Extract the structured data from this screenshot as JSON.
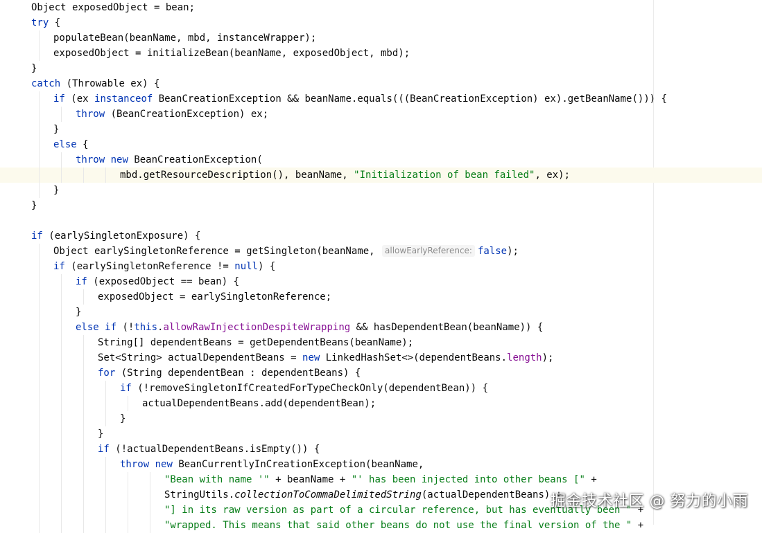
{
  "editor": {
    "lines": [
      {
        "indent": 1,
        "tokens": [
          {
            "t": "Object exposedObject = bean;"
          }
        ]
      },
      {
        "indent": 1,
        "tokens": [
          {
            "t": "try",
            "c": "kw"
          },
          {
            "t": " {"
          }
        ]
      },
      {
        "indent": 2,
        "tokens": [
          {
            "t": "populateBean(beanName, mbd, instanceWrapper);"
          }
        ]
      },
      {
        "indent": 2,
        "tokens": [
          {
            "t": "exposedObject = initializeBean(beanName, exposedObject, mbd);"
          }
        ]
      },
      {
        "indent": 1,
        "tokens": [
          {
            "t": "}"
          }
        ]
      },
      {
        "indent": 1,
        "tokens": [
          {
            "t": "catch",
            "c": "kw"
          },
          {
            "t": " (Throwable ex) {"
          }
        ]
      },
      {
        "indent": 2,
        "tokens": [
          {
            "t": "if",
            "c": "kw"
          },
          {
            "t": " (ex "
          },
          {
            "t": "instanceof",
            "c": "kw"
          },
          {
            "t": " BeanCreationException && beanName.equals(((BeanCreationException) ex).getBeanName())) {"
          }
        ]
      },
      {
        "indent": 3,
        "tokens": [
          {
            "t": "throw",
            "c": "kw"
          },
          {
            "t": " (BeanCreationException) ex;"
          }
        ]
      },
      {
        "indent": 2,
        "tokens": [
          {
            "t": "}"
          }
        ]
      },
      {
        "indent": 2,
        "tokens": [
          {
            "t": "else",
            "c": "kw"
          },
          {
            "t": " {"
          }
        ]
      },
      {
        "indent": 3,
        "tokens": [
          {
            "t": "throw",
            "c": "kw"
          },
          {
            "t": " "
          },
          {
            "t": "new",
            "c": "kw"
          },
          {
            "t": " BeanCreationException("
          }
        ]
      },
      {
        "indent": 5,
        "highlight": true,
        "tokens": [
          {
            "t": "mbd.getResourceDescription(), beanName, "
          },
          {
            "t": "\"Initialization of bean failed\"",
            "c": "str"
          },
          {
            "t": ", ex);"
          }
        ]
      },
      {
        "indent": 2,
        "tokens": [
          {
            "t": "}"
          }
        ]
      },
      {
        "indent": 1,
        "tokens": [
          {
            "t": "}"
          }
        ]
      },
      {
        "indent": 1,
        "tokens": []
      },
      {
        "indent": 1,
        "tokens": [
          {
            "t": "if",
            "c": "kw"
          },
          {
            "t": " (earlySingletonExposure) {"
          }
        ]
      },
      {
        "indent": 2,
        "tokens": [
          {
            "t": "Object earlySingletonReference = getSingleton(beanName, "
          },
          {
            "t": "allowEarlyReference:",
            "c": "hint"
          },
          {
            "t": "false",
            "c": "kw"
          },
          {
            "t": ");"
          }
        ]
      },
      {
        "indent": 2,
        "tokens": [
          {
            "t": "if",
            "c": "kw"
          },
          {
            "t": " (earlySingletonReference != "
          },
          {
            "t": "null",
            "c": "kw"
          },
          {
            "t": ") {"
          }
        ]
      },
      {
        "indent": 3,
        "tokens": [
          {
            "t": "if",
            "c": "kw"
          },
          {
            "t": " (exposedObject == bean) {"
          }
        ]
      },
      {
        "indent": 4,
        "tokens": [
          {
            "t": "exposedObject = earlySingletonReference;"
          }
        ]
      },
      {
        "indent": 3,
        "tokens": [
          {
            "t": "}"
          }
        ]
      },
      {
        "indent": 3,
        "tokens": [
          {
            "t": "else if",
            "c": "kw"
          },
          {
            "t": " (!"
          },
          {
            "t": "this",
            "c": "kw"
          },
          {
            "t": "."
          },
          {
            "t": "allowRawInjectionDespiteWrapping",
            "c": "fld"
          },
          {
            "t": " && hasDependentBean(beanName)) {"
          }
        ]
      },
      {
        "indent": 4,
        "tokens": [
          {
            "t": "String[] dependentBeans = getDependentBeans(beanName);"
          }
        ]
      },
      {
        "indent": 4,
        "tokens": [
          {
            "t": "Set<String> actualDependentBeans = "
          },
          {
            "t": "new",
            "c": "kw"
          },
          {
            "t": " LinkedHashSet<>(dependentBeans."
          },
          {
            "t": "length",
            "c": "fld"
          },
          {
            "t": ");"
          }
        ]
      },
      {
        "indent": 4,
        "tokens": [
          {
            "t": "for",
            "c": "kw"
          },
          {
            "t": " (String dependentBean : dependentBeans) {"
          }
        ]
      },
      {
        "indent": 5,
        "tokens": [
          {
            "t": "if",
            "c": "kw"
          },
          {
            "t": " (!removeSingletonIfCreatedForTypeCheckOnly(dependentBean)) {"
          }
        ]
      },
      {
        "indent": 6,
        "tokens": [
          {
            "t": "actualDependentBeans.add(dependentBean);"
          }
        ]
      },
      {
        "indent": 5,
        "tokens": [
          {
            "t": "}"
          }
        ]
      },
      {
        "indent": 4,
        "tokens": [
          {
            "t": "}"
          }
        ]
      },
      {
        "indent": 4,
        "tokens": [
          {
            "t": "if",
            "c": "kw"
          },
          {
            "t": " (!actualDependentBeans.isEmpty()) {"
          }
        ]
      },
      {
        "indent": 5,
        "tokens": [
          {
            "t": "throw",
            "c": "kw"
          },
          {
            "t": " "
          },
          {
            "t": "new",
            "c": "kw"
          },
          {
            "t": " BeanCurrentlyInCreationException(beanName,"
          }
        ]
      },
      {
        "indent": 7,
        "tokens": [
          {
            "t": "\"Bean with name '\"",
            "c": "str"
          },
          {
            "t": " + beanName + "
          },
          {
            "t": "\"' has been injected into other beans [\"",
            "c": "str"
          },
          {
            "t": " +"
          }
        ]
      },
      {
        "indent": 7,
        "tokens": [
          {
            "t": "StringUtils."
          },
          {
            "t": "collectionToCommaDelimitedString",
            "c": "it"
          },
          {
            "t": "(actualDependentBeans) +"
          }
        ]
      },
      {
        "indent": 7,
        "tokens": [
          {
            "t": "\"] in its raw version as part of a circular reference, but has eventually been \"",
            "c": "str"
          },
          {
            "t": " +"
          }
        ]
      },
      {
        "indent": 7,
        "tokens": [
          {
            "t": "\"wrapped. This means that said other beans do not use the final version of the \"",
            "c": "str"
          },
          {
            "t": " +"
          }
        ]
      }
    ]
  },
  "watermark": "掘金技术社区 @ 努力的小雨",
  "colors": {
    "keyword": "#0033b3",
    "string": "#067d17",
    "field": "#871094",
    "text": "#080808",
    "hint": "#8c8c8c",
    "current_line": "#fcfaed"
  }
}
